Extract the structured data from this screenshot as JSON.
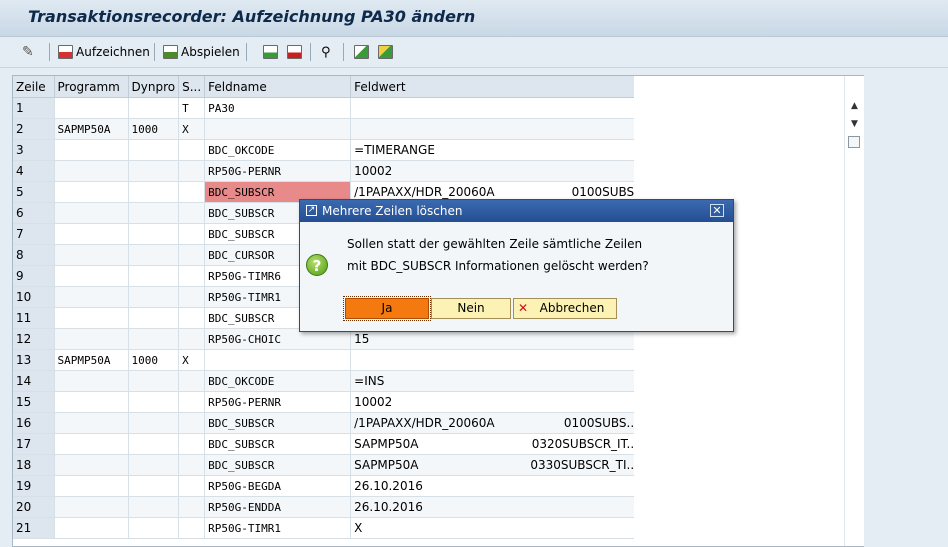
{
  "window": {
    "title": "Transaktionsrecorder: Aufzeichnung PA30 ändern"
  },
  "toolbar": {
    "record_label": "Aufzeichnen",
    "play_label": "Abspielen"
  },
  "grid": {
    "columns": [
      "Zeile",
      "Programm",
      "Dynpro",
      "S...",
      "Feldname",
      "Feldwert"
    ],
    "rows": [
      {
        "zeile": "1",
        "programm": "",
        "dynpro": "",
        "s": "T",
        "feld": "PA30",
        "wert": "",
        "wert2": ""
      },
      {
        "zeile": "2",
        "programm": "SAPMP50A",
        "dynpro": "1000",
        "s": "X",
        "feld": "",
        "wert": "",
        "wert2": ""
      },
      {
        "zeile": "3",
        "programm": "",
        "dynpro": "",
        "s": "",
        "feld": "BDC_OKCODE",
        "wert": "=TIMERANGE",
        "wert2": ""
      },
      {
        "zeile": "4",
        "programm": "",
        "dynpro": "",
        "s": "",
        "feld": "RP50G-PERNR",
        "wert": "10002",
        "wert2": ""
      },
      {
        "zeile": "5",
        "programm": "",
        "dynpro": "",
        "s": "",
        "feld": "BDC_SUBSCR",
        "wert": "/1PAPAXX/HDR_20060A",
        "wert2": "0100SUBS"
      },
      {
        "zeile": "6",
        "programm": "",
        "dynpro": "",
        "s": "",
        "feld": "BDC_SUBSCR",
        "wert": "",
        "wert2": ""
      },
      {
        "zeile": "7",
        "programm": "",
        "dynpro": "",
        "s": "",
        "feld": "BDC_SUBSCR",
        "wert": "",
        "wert2": ""
      },
      {
        "zeile": "8",
        "programm": "",
        "dynpro": "",
        "s": "",
        "feld": "BDC_CURSOR",
        "wert": "",
        "wert2": ""
      },
      {
        "zeile": "9",
        "programm": "",
        "dynpro": "",
        "s": "",
        "feld": "RP50G-TIMR6",
        "wert": "",
        "wert2": ""
      },
      {
        "zeile": "10",
        "programm": "",
        "dynpro": "",
        "s": "",
        "feld": "RP50G-TIMR1",
        "wert": "",
        "wert2": ""
      },
      {
        "zeile": "11",
        "programm": "",
        "dynpro": "",
        "s": "",
        "feld": "BDC_SUBSCR",
        "wert": "",
        "wert2": ""
      },
      {
        "zeile": "12",
        "programm": "",
        "dynpro": "",
        "s": "",
        "feld": "RP50G-CHOIC",
        "wert": "15",
        "wert2": ""
      },
      {
        "zeile": "13",
        "programm": "SAPMP50A",
        "dynpro": "1000",
        "s": "X",
        "feld": "",
        "wert": "",
        "wert2": ""
      },
      {
        "zeile": "14",
        "programm": "",
        "dynpro": "",
        "s": "",
        "feld": "BDC_OKCODE",
        "wert": "=INS",
        "wert2": ""
      },
      {
        "zeile": "15",
        "programm": "",
        "dynpro": "",
        "s": "",
        "feld": "RP50G-PERNR",
        "wert": "10002",
        "wert2": ""
      },
      {
        "zeile": "16",
        "programm": "",
        "dynpro": "",
        "s": "",
        "feld": "BDC_SUBSCR",
        "wert": "/1PAPAXX/HDR_20060A",
        "wert2": "0100SUBS.."
      },
      {
        "zeile": "17",
        "programm": "",
        "dynpro": "",
        "s": "",
        "feld": "BDC_SUBSCR",
        "wert": "SAPMP50A",
        "wert2": "0320SUBSCR_IT.."
      },
      {
        "zeile": "18",
        "programm": "",
        "dynpro": "",
        "s": "",
        "feld": "BDC_SUBSCR",
        "wert": "SAPMP50A",
        "wert2": "0330SUBSCR_TI.."
      },
      {
        "zeile": "19",
        "programm": "",
        "dynpro": "",
        "s": "",
        "feld": "RP50G-BEGDA",
        "wert": "26.10.2016",
        "wert2": ""
      },
      {
        "zeile": "20",
        "programm": "",
        "dynpro": "",
        "s": "",
        "feld": "RP50G-ENDDA",
        "wert": "26.10.2016",
        "wert2": ""
      },
      {
        "zeile": "21",
        "programm": "",
        "dynpro": "",
        "s": "",
        "feld": "RP50G-TIMR1",
        "wert": "X",
        "wert2": ""
      }
    ],
    "highlight_row": 5,
    "highlight_color": "#e88a8a"
  },
  "dialog": {
    "title": "Mehrere Zeilen löschen",
    "message_line1": "Sollen statt der gewählten Zeile sämtliche Zeilen",
    "message_line2": "mit BDC_SUBSCR Informationen gelöscht werden?",
    "yes_label": "Ja",
    "no_label": "Nein",
    "cancel_label": "Abbrechen",
    "icon": "question-icon"
  },
  "colors": {
    "yes_button": "#f47a10",
    "dialog_title_bar": "#2a5698",
    "button_face": "#fcf2b3"
  }
}
